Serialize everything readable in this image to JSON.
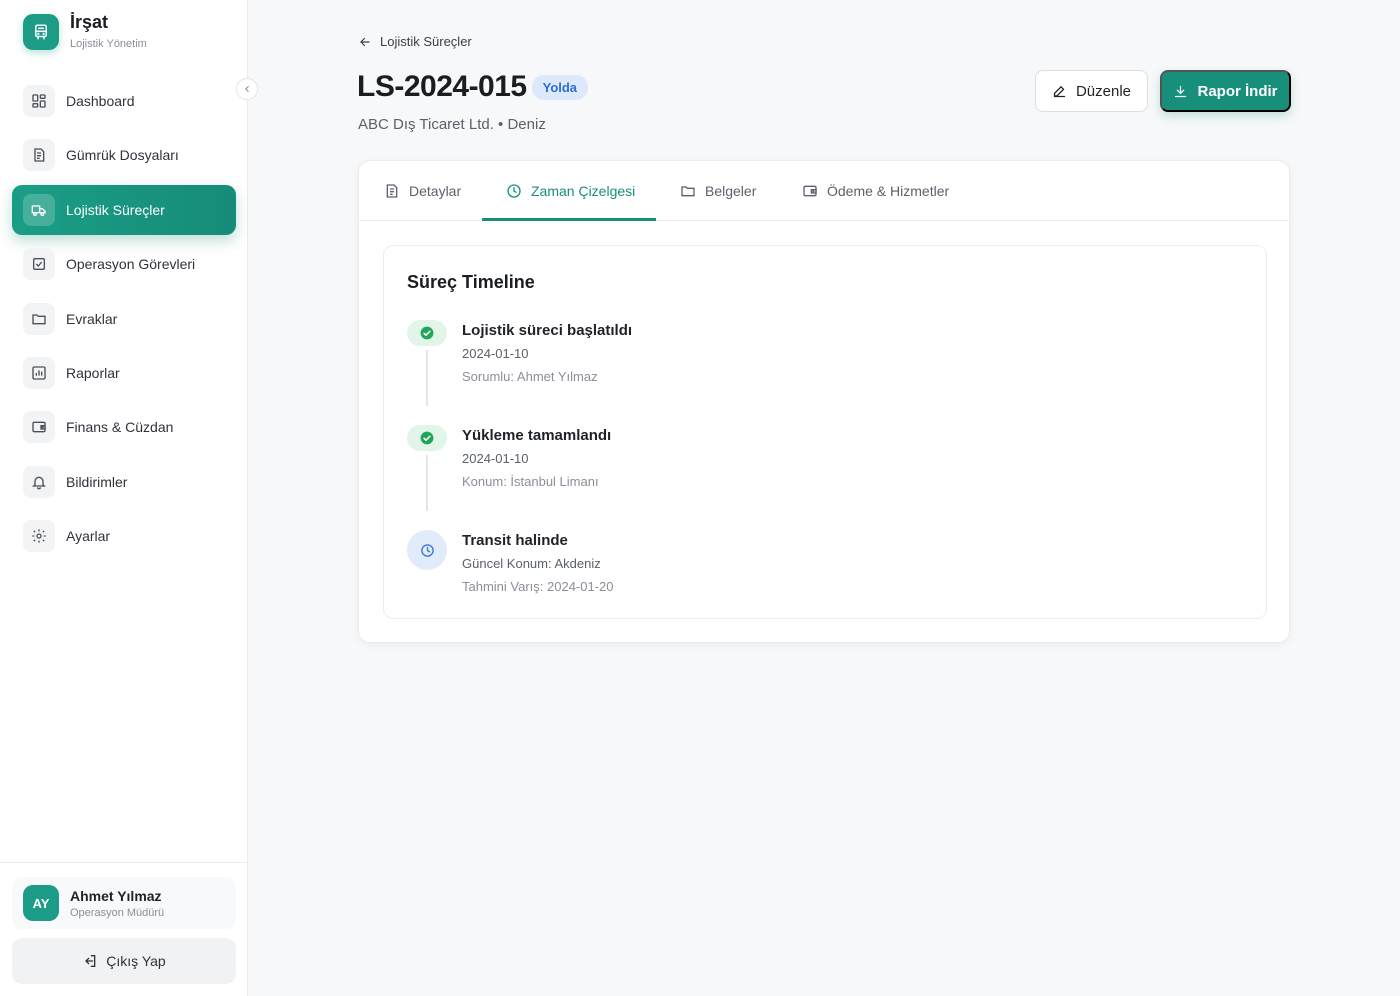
{
  "brand": {
    "title": "İrşat",
    "subtitle": "Lojistik Yönetim",
    "icon": "bus-icon",
    "accent": "#1c9b86"
  },
  "sidebar": {
    "items": [
      {
        "label": "Dashboard",
        "icon": "grid-icon",
        "active": false
      },
      {
        "label": "Gümrük Dosyaları",
        "icon": "file-text-icon",
        "active": false
      },
      {
        "label": "Lojistik Süreçler",
        "icon": "truck-icon",
        "active": true
      },
      {
        "label": "Operasyon Görevleri",
        "icon": "check-square-icon",
        "active": false
      },
      {
        "label": "Evraklar",
        "icon": "folder-icon",
        "active": false
      },
      {
        "label": "Raporlar",
        "icon": "bar-chart-icon",
        "active": false
      },
      {
        "label": "Finans & Cüzdan",
        "icon": "wallet-icon",
        "active": false
      },
      {
        "label": "Bildirimler",
        "icon": "bell-icon",
        "active": false
      },
      {
        "label": "Ayarlar",
        "icon": "gear-icon",
        "active": false
      }
    ]
  },
  "user": {
    "initials": "AY",
    "name": "Ahmet Yılmaz",
    "role": "Operasyon Müdürü"
  },
  "logout_label": "Çıkış Yap",
  "breadcrumb": {
    "back_label": "Lojistik Süreçler"
  },
  "page": {
    "title": "LS-2024-015",
    "status": "Yolda",
    "subtitle": "ABC Dış Ticaret Ltd. • Deniz"
  },
  "actions": {
    "edit_label": "Düzenle",
    "report_label": "Rapor İndir"
  },
  "tabs": [
    {
      "label": "Detaylar",
      "icon": "document-icon",
      "active": false
    },
    {
      "label": "Zaman Çizelgesi",
      "icon": "clock-icon",
      "active": true
    },
    {
      "label": "Belgeler",
      "icon": "folder-icon",
      "active": false
    },
    {
      "label": "Ödeme & Hizmetler",
      "icon": "wallet-icon",
      "active": false
    }
  ],
  "timeline": {
    "title": "Süreç Timeline",
    "items": [
      {
        "title": "Lojistik süreci başlatıldı",
        "line1": "2024-01-10",
        "line2": "Sorumlu: Ahmet Yılmaz",
        "state": "done"
      },
      {
        "title": "Yükleme tamamlandı",
        "line1": "2024-01-10",
        "line2": "Konum: İstanbul Limanı",
        "state": "done"
      },
      {
        "title": "Transit halinde",
        "line1": "Güncel Konum: Akdeniz",
        "line2": "Tahmini Varış: 2024-01-20",
        "state": "in-progress"
      }
    ]
  },
  "colors": {
    "primary": "#178f7b",
    "done": "#22a45d",
    "in_progress": "#3b78d8",
    "badge_bg": "#dde9fb"
  }
}
